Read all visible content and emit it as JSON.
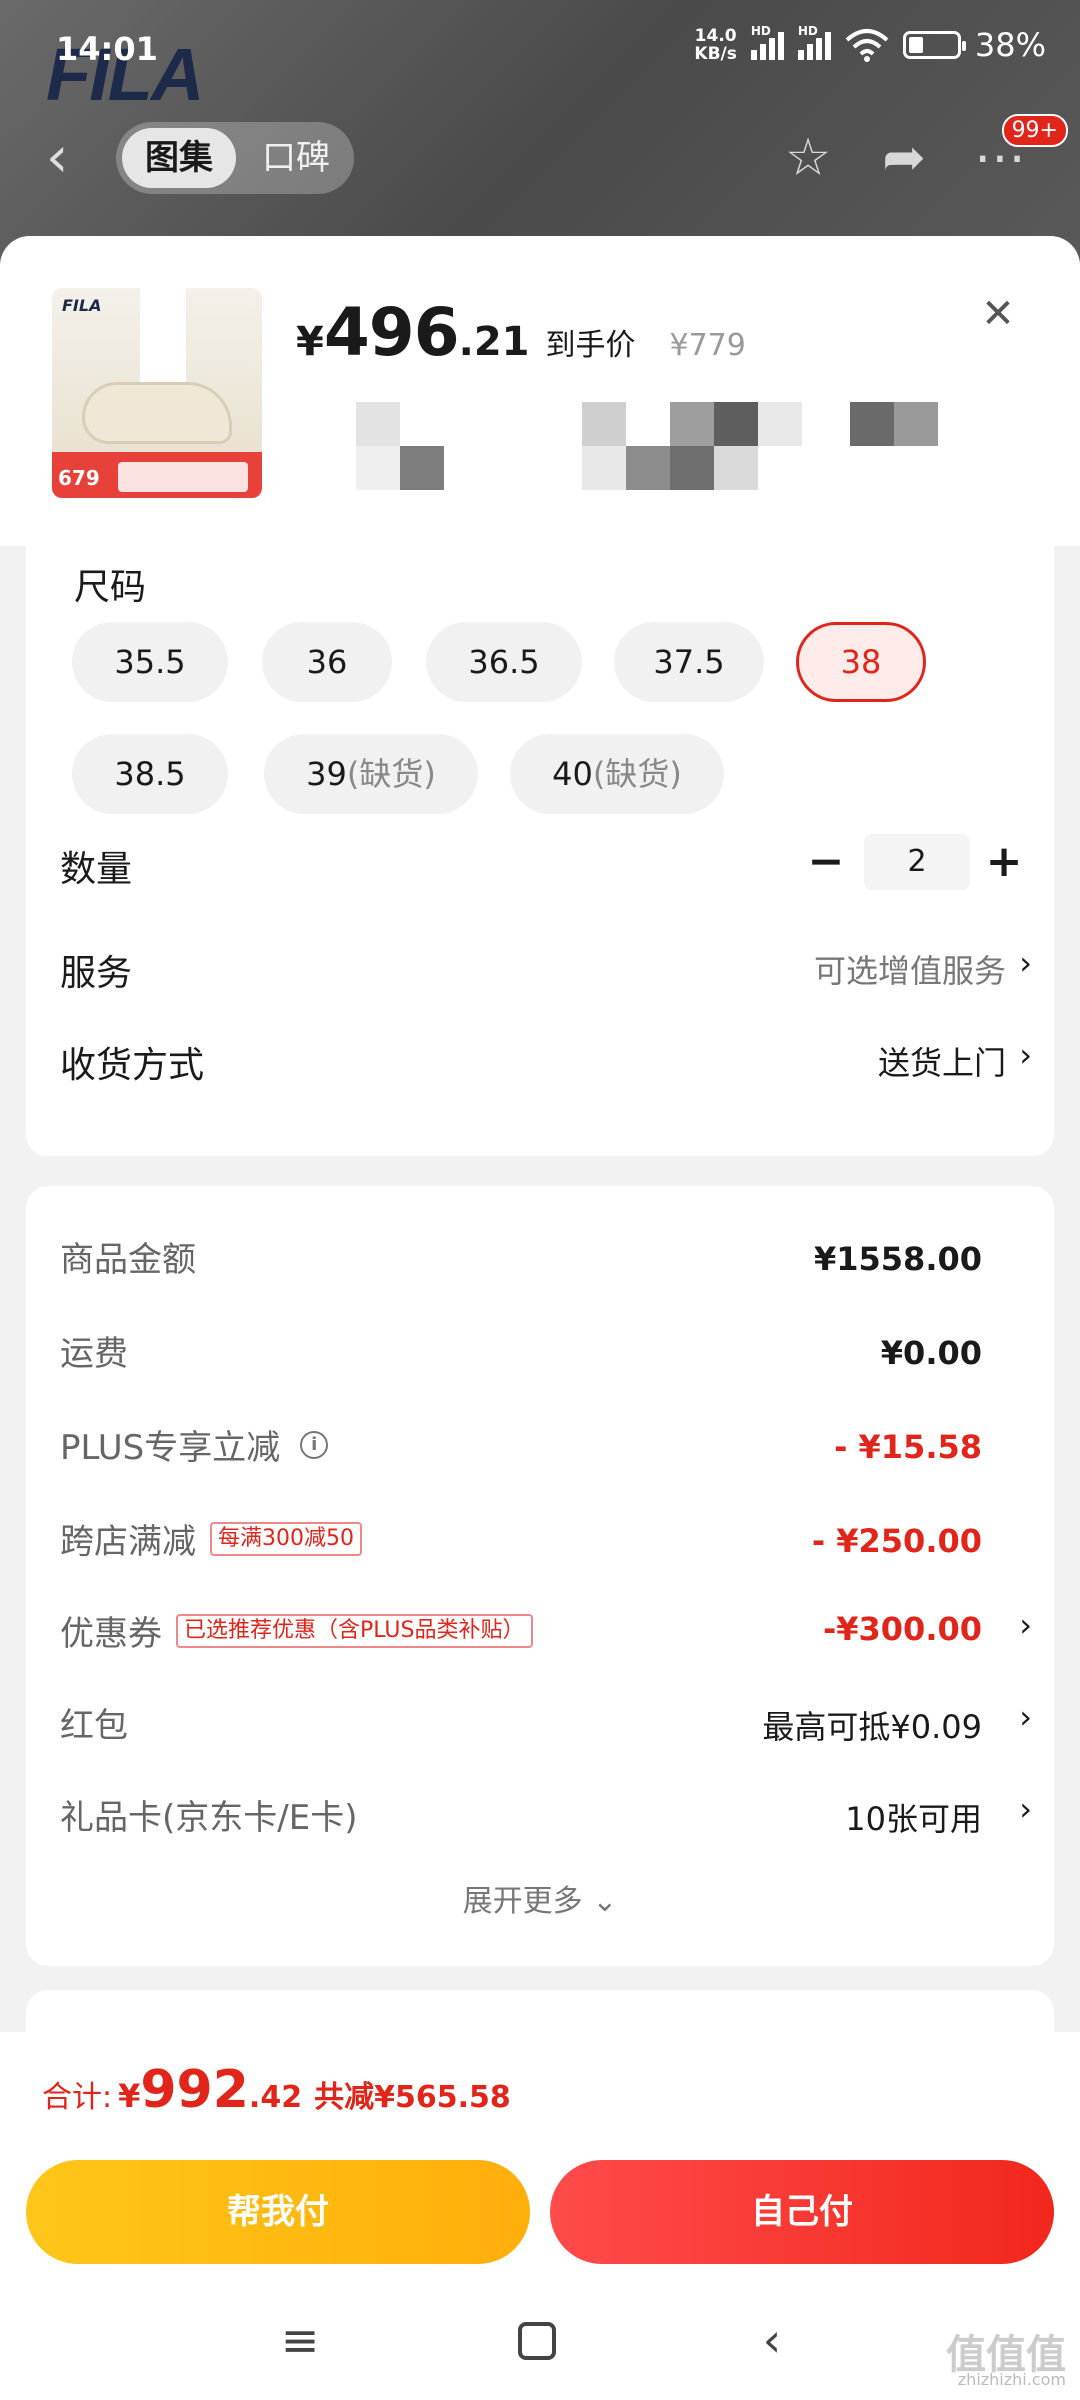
{
  "status_bar": {
    "time": "14:01",
    "net_speed": "14.0",
    "net_unit": "KB/s",
    "hd1": "HD",
    "hd2": "HD",
    "battery": "38%"
  },
  "background": {
    "brand": "FILA"
  },
  "top_nav": {
    "tab_active": "图集",
    "tab_inactive": "口碑",
    "badge": "99+",
    "icons": [
      "back-icon",
      "star-icon",
      "share-icon",
      "more-icon"
    ]
  },
  "product": {
    "thumb_brand": "FILA",
    "thumb_price": "679",
    "price_yen": "¥",
    "price_int": "496",
    "price_dec": ".21",
    "price_label": "到手价",
    "original_price": "¥779"
  },
  "size_section": {
    "title": "尺码",
    "sizes": [
      {
        "label": "35.5",
        "note": ""
      },
      {
        "label": "36",
        "note": ""
      },
      {
        "label": "36.5",
        "note": ""
      },
      {
        "label": "37.5",
        "note": ""
      },
      {
        "label": "38",
        "note": ""
      },
      {
        "label": "38.5",
        "note": ""
      },
      {
        "label": "39",
        "note": "(缺货)"
      },
      {
        "label": "40",
        "note": "(缺货)"
      }
    ],
    "selected": "38"
  },
  "quantity": {
    "label": "数量",
    "value": "2",
    "minus": "−",
    "plus": "+"
  },
  "service": {
    "label": "服务",
    "value": "可选增值服务"
  },
  "delivery": {
    "label": "收货方式",
    "value": "送货上门"
  },
  "price_breakdown": {
    "goods_amount": {
      "label": "商品金额",
      "value": "¥1558.00"
    },
    "shipping": {
      "label": "运费",
      "value": "¥0.00"
    },
    "plus_discount": {
      "label": "PLUS专享立减",
      "value": "- ¥15.58"
    },
    "cross_store": {
      "label": "跨店满减",
      "tag": "每满300减50",
      "value": "- ¥250.00"
    },
    "coupon": {
      "label": "优惠券",
      "tag": "已选推荐优惠（含PLUS品类补贴）",
      "value": "-¥300.00"
    },
    "red_packet": {
      "label": "红包",
      "value": "最高可抵¥0.09"
    },
    "gift_card": {
      "label": "礼品卡(京东卡/E卡)",
      "value": "10张可用"
    },
    "expand": "展开更多 ⌄"
  },
  "footer": {
    "total_label": "合计:",
    "total_yen": "¥",
    "total_int": "992",
    "total_dec": ".42",
    "saved": "共减¥565.58",
    "btn_help": "帮我付",
    "btn_self": "自己付"
  },
  "watermark": {
    "text": "值值值",
    "url": "zhizhizhi.com"
  },
  "colors": {
    "accent_red": "#e1251b",
    "help_btn": "#ffb914",
    "self_btn": "#f5301f"
  }
}
